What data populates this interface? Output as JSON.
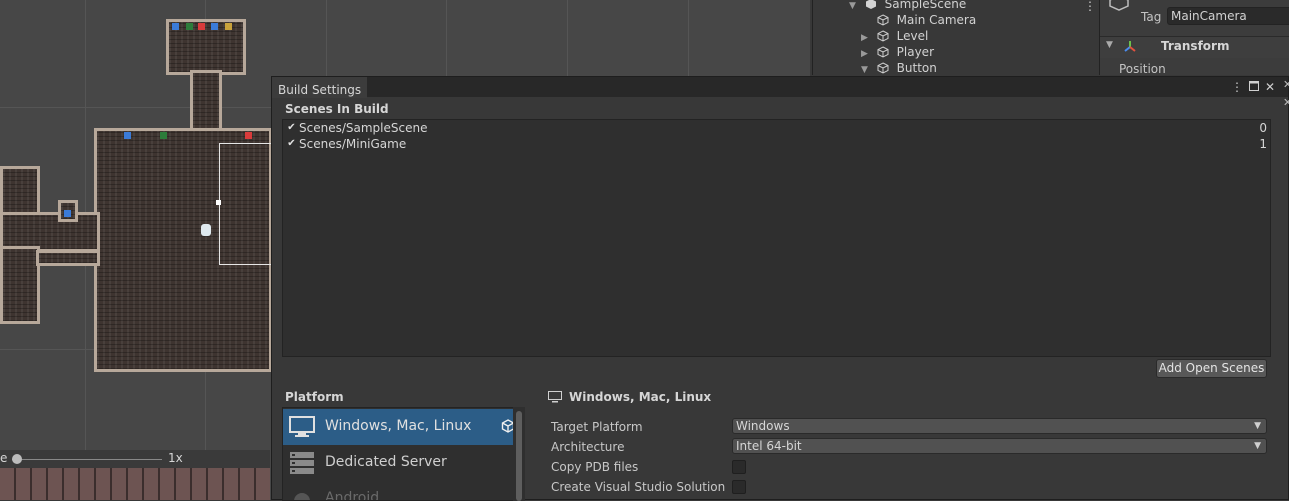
{
  "scene_view": {
    "zoom_prefix": "e",
    "zoom_label": "1x",
    "decor_colors": [
      "#3b7bd8",
      "#2c7c3a",
      "#d93b3b",
      "#3b7bd8",
      "#c9a23b"
    ]
  },
  "hierarchy": {
    "items": [
      {
        "label": "SampleScene",
        "expanded": true
      },
      {
        "label": "Main Camera",
        "expanded": null
      },
      {
        "label": "Level",
        "expanded": false
      },
      {
        "label": "Player",
        "expanded": false
      },
      {
        "label": "Button",
        "expanded": true
      }
    ],
    "menu_icon": "vertical-ellipsis-icon"
  },
  "inspector": {
    "tag_label": "Tag",
    "tag_value": "MainCamera",
    "transform_title": "Transform",
    "position_label": "Position"
  },
  "build_settings": {
    "title": "Build Settings",
    "title_buttons": [
      "kebab-menu-icon",
      "maximize-icon",
      "close-icon"
    ],
    "scenes_header": "Scenes In Build",
    "scenes": [
      {
        "name": "Scenes/SampleScene",
        "checked": true,
        "index": "0"
      },
      {
        "name": "Scenes/MiniGame",
        "checked": true,
        "index": "1"
      }
    ],
    "add_open_scenes": "Add Open Scenes",
    "platform_header": "Platform",
    "platforms": [
      {
        "label": "Windows, Mac, Linux",
        "icon": "monitor-icon",
        "selected": true
      },
      {
        "label": "Dedicated Server",
        "icon": "server-icon",
        "selected": false
      },
      {
        "label": "Android",
        "icon": "android-icon",
        "selected": false
      }
    ],
    "details": {
      "title": "Windows, Mac, Linux",
      "target_platform_label": "Target Platform",
      "target_platform_value": "Windows",
      "architecture_label": "Architecture",
      "architecture_value": "Intel 64-bit",
      "copy_pdb_label": "Copy PDB files",
      "copy_pdb_checked": false,
      "create_vs_label": "Create Visual Studio Solution",
      "create_vs_checked": false
    }
  },
  "colors": {
    "selection": "#2c5d87",
    "panel": "#383838",
    "list_bg": "#2f2f2f"
  }
}
